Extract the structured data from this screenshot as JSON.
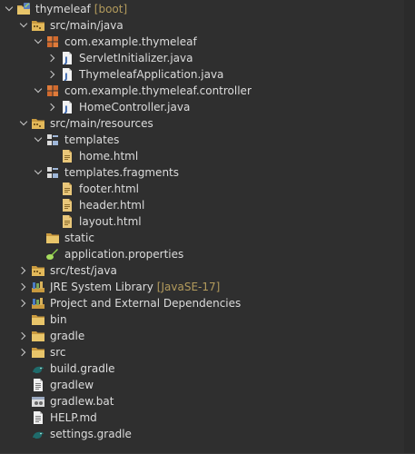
{
  "tree": [
    {
      "label": "thymeleaf",
      "decoration": "[boot]",
      "icon": "project-icon",
      "depth": 0,
      "expand": "open"
    },
    {
      "label": "src/main/java",
      "icon": "source-folder-icon",
      "depth": 1,
      "expand": "open"
    },
    {
      "label": "com.example.thymeleaf",
      "icon": "package-icon",
      "depth": 2,
      "expand": "open"
    },
    {
      "label": "ServletInitializer.java",
      "icon": "java-file-icon",
      "depth": 3,
      "expand": "closed"
    },
    {
      "label": "ThymeleafApplication.java",
      "icon": "java-file-icon",
      "depth": 3,
      "expand": "closed"
    },
    {
      "label": "com.example.thymeleaf.controller",
      "icon": "package-icon",
      "depth": 2,
      "expand": "open"
    },
    {
      "label": "HomeController.java",
      "icon": "java-file-icon",
      "depth": 3,
      "expand": "closed"
    },
    {
      "label": "src/main/resources",
      "icon": "source-folder-icon",
      "depth": 1,
      "expand": "open"
    },
    {
      "label": "templates",
      "icon": "templates-folder-icon",
      "depth": 2,
      "expand": "open"
    },
    {
      "label": "home.html",
      "icon": "html-file-icon",
      "depth": 3,
      "expand": "none"
    },
    {
      "label": "templates.fragments",
      "icon": "templates-folder-icon",
      "depth": 2,
      "expand": "open"
    },
    {
      "label": "footer.html",
      "icon": "html-file-icon",
      "depth": 3,
      "expand": "none"
    },
    {
      "label": "header.html",
      "icon": "html-file-icon",
      "depth": 3,
      "expand": "none"
    },
    {
      "label": "layout.html",
      "icon": "html-file-icon",
      "depth": 3,
      "expand": "none"
    },
    {
      "label": "static",
      "icon": "folder-icon",
      "depth": 2,
      "expand": "none"
    },
    {
      "label": "application.properties",
      "icon": "properties-file-icon",
      "depth": 2,
      "expand": "none"
    },
    {
      "label": "src/test/java",
      "icon": "source-folder-icon",
      "depth": 1,
      "expand": "closed"
    },
    {
      "label": "JRE System Library",
      "decoration": "[JavaSE-17]",
      "icon": "library-icon",
      "depth": 1,
      "expand": "closed"
    },
    {
      "label": "Project and External Dependencies",
      "icon": "library-icon",
      "depth": 1,
      "expand": "closed"
    },
    {
      "label": "bin",
      "icon": "folder-icon",
      "depth": 1,
      "expand": "none"
    },
    {
      "label": "gradle",
      "icon": "folder-icon",
      "depth": 1,
      "expand": "closed"
    },
    {
      "label": "src",
      "icon": "folder-icon",
      "depth": 1,
      "expand": "closed"
    },
    {
      "label": "build.gradle",
      "icon": "gradle-file-icon",
      "depth": 1,
      "expand": "none"
    },
    {
      "label": "gradlew",
      "icon": "text-file-icon",
      "depth": 1,
      "expand": "none"
    },
    {
      "label": "gradlew.bat",
      "icon": "bat-file-icon",
      "depth": 1,
      "expand": "none"
    },
    {
      "label": "HELP.md",
      "icon": "text-file-icon",
      "depth": 1,
      "expand": "none"
    },
    {
      "label": "settings.gradle",
      "icon": "gradle-file-icon",
      "depth": 1,
      "expand": "none"
    }
  ]
}
